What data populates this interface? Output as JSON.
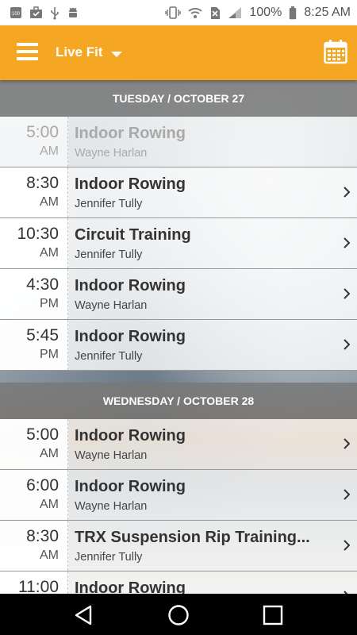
{
  "status_bar": {
    "battery": "100%",
    "time": "8:25 AM",
    "left_icons": [
      "tally-100-icon",
      "briefcase-check-icon",
      "usb-icon",
      "android-icon"
    ],
    "right_icons": [
      "vibrate-icon",
      "wifi-icon",
      "no-sim-icon",
      "signal-icon",
      "battery-icon"
    ]
  },
  "app_bar": {
    "title": "Live Fit",
    "background": "#f5a623"
  },
  "schedule": [
    {
      "day": "TUESDAY / OCTOBER 27",
      "classes": [
        {
          "time": "5:00",
          "ampm": "AM",
          "name": "Indoor Rowing",
          "instructor": "Wayne Harlan",
          "past": true
        },
        {
          "time": "8:30",
          "ampm": "AM",
          "name": "Indoor Rowing",
          "instructor": "Jennifer Tully",
          "past": false
        },
        {
          "time": "10:30",
          "ampm": "AM",
          "name": "Circuit Training",
          "instructor": "Jennifer Tully",
          "past": false
        },
        {
          "time": "4:30",
          "ampm": "PM",
          "name": "Indoor Rowing",
          "instructor": "Wayne Harlan",
          "past": false
        },
        {
          "time": "5:45",
          "ampm": "PM",
          "name": "Indoor Rowing",
          "instructor": "Jennifer Tully",
          "past": false
        }
      ]
    },
    {
      "day": "WEDNESDAY / OCTOBER 28",
      "classes": [
        {
          "time": "5:00",
          "ampm": "AM",
          "name": "Indoor Rowing",
          "instructor": "Wayne Harlan",
          "past": false
        },
        {
          "time": "6:00",
          "ampm": "AM",
          "name": "Indoor Rowing",
          "instructor": "Wayne Harlan",
          "past": false
        },
        {
          "time": "8:30",
          "ampm": "AM",
          "name": "TRX Suspension Rip Training...",
          "instructor": "Jennifer Tully",
          "past": false
        },
        {
          "time": "11:00",
          "ampm": "",
          "name": "Indoor Rowing",
          "instructor": "",
          "past": false
        }
      ]
    }
  ]
}
